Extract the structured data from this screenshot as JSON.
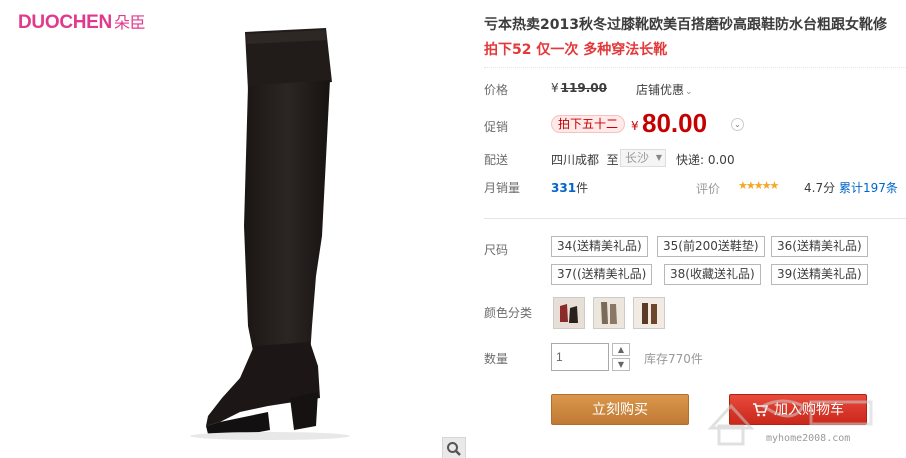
{
  "brand": {
    "name": "DUOCHEN",
    "name_cn": "朵臣"
  },
  "product": {
    "title": "亏本热卖2013秋冬过膝靴欧美百搭磨砂高跟鞋防水台粗跟女靴修",
    "subtitle": "拍下52 仅一次 多种穿法长靴"
  },
  "price": {
    "label": "价格",
    "currency": "¥",
    "original": "119.00",
    "shop_promo_label": "店铺优惠",
    "promo_label": "促销",
    "promo_tag": "拍下五十二",
    "promo_price": "80.00"
  },
  "shipping": {
    "label": "配送",
    "from": "四川成都",
    "to_prefix": "至",
    "to": "长沙",
    "fee": "快递: 0.00"
  },
  "sales": {
    "label": "月销量",
    "count": "331",
    "unit": "件",
    "rating_label": "评价",
    "stars": "★★★★★",
    "score": "4.7分",
    "reviews": "累计197条"
  },
  "size": {
    "label": "尺码",
    "options": [
      "34(送精美礼品)",
      "35(前200送鞋垫)",
      "36(送精美礼品)",
      "37((送精美礼品)",
      "38(收藏送礼品)",
      "39(送精美礼品)"
    ]
  },
  "color": {
    "label": "颜色分类"
  },
  "quantity": {
    "label": "数量",
    "value": "1",
    "stock": "库存770件"
  },
  "actions": {
    "buy_now": "立刻购买",
    "add_cart": "加入购物车"
  },
  "watermark": {
    "text": "myhome2008.com"
  },
  "colors": {
    "brand": "#e13a8d",
    "price": "#c40000",
    "buy": "#c9853a",
    "cart": "#d9342a",
    "link": "#0066cc"
  }
}
